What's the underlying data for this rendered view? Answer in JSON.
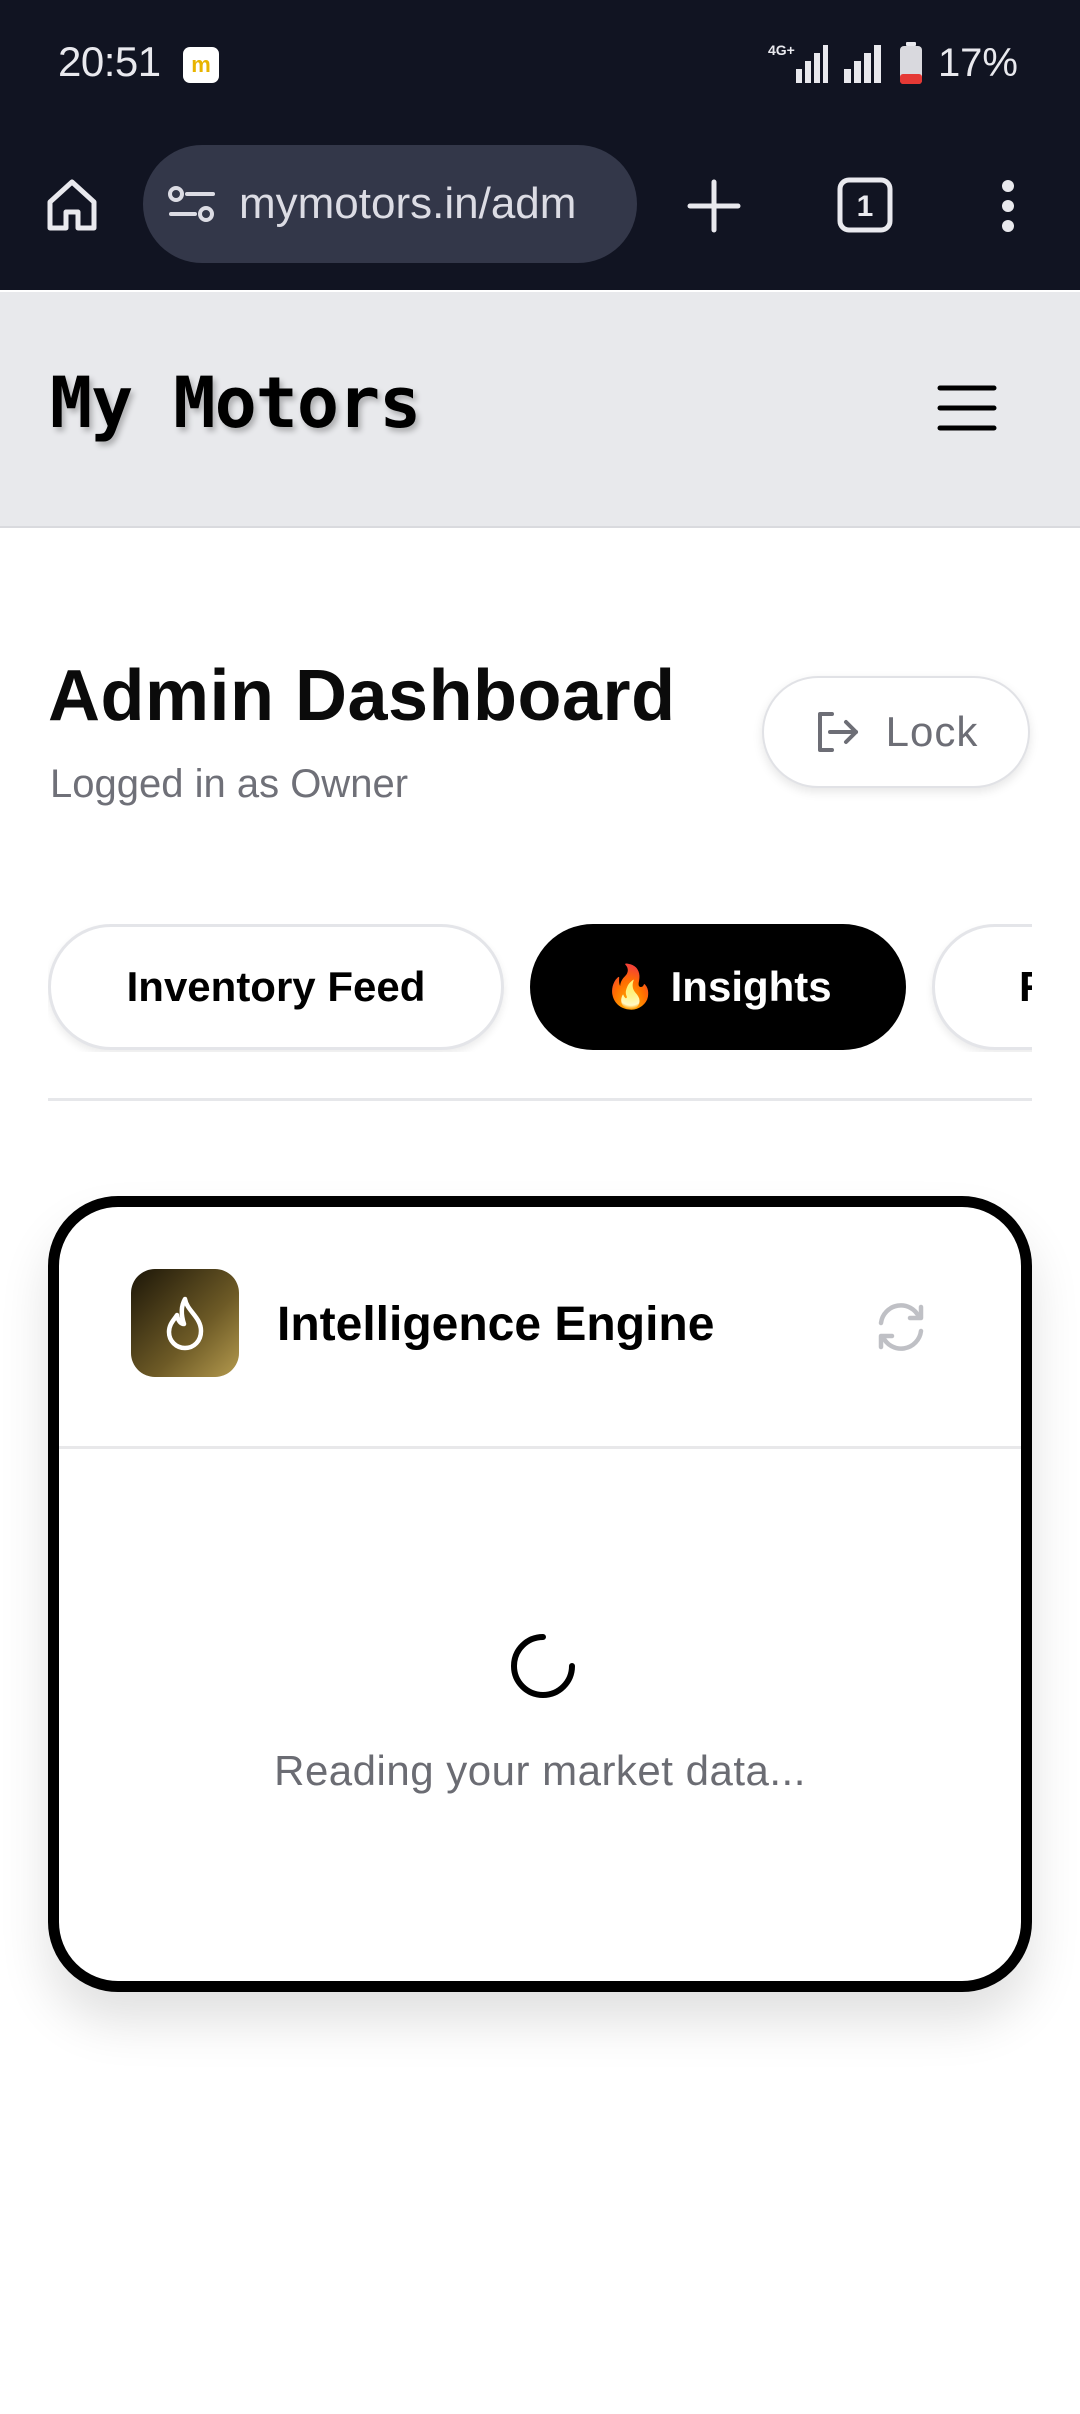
{
  "status_bar": {
    "time": "20:51",
    "app_badge": "m",
    "network_label": "4G+",
    "battery_percent": "17%"
  },
  "browser": {
    "url": "mymotors.in/adm",
    "tab_count": "1"
  },
  "header": {
    "brand": "My Motors"
  },
  "page": {
    "title": "Admin Dashboard",
    "subtitle": "Logged in as Owner",
    "lock_label": "Lock"
  },
  "tabs": [
    {
      "label": "Inventory Feed",
      "active": false
    },
    {
      "label": "Insights",
      "emoji": "🔥",
      "active": true
    },
    {
      "label": "R",
      "active": false
    }
  ],
  "card": {
    "title": "Intelligence Engine",
    "loading_text": "Reading your market data..."
  },
  "colors": {
    "status_bg": "#111422",
    "url_box_bg": "#333749",
    "header_bg": "#e8e9ec",
    "active_tab_bg": "#000000",
    "battery_low": "#e53935",
    "card_icon_gold": "#b49a4e"
  }
}
